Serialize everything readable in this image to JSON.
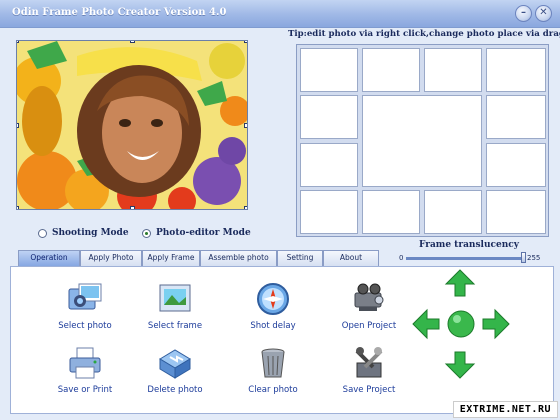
{
  "window": {
    "title": "Odin Frame Photo Creator Version 4.0",
    "minimize_icon": "minimize-icon",
    "close_icon": "close-icon"
  },
  "preview": {
    "photo_description_icon": "portrait-with-fruit-frame",
    "modes": [
      {
        "label": "Shooting Mode",
        "selected": false
      },
      {
        "label": "Photo-editor Mode",
        "selected": true
      }
    ]
  },
  "tip": "Tip:edit photo via right click,change photo place via drag it",
  "frame_translucency": {
    "label": "Frame translucency",
    "min": "0",
    "max": "255",
    "value": 255
  },
  "tabs": [
    {
      "label": "Operation",
      "active": true
    },
    {
      "label": "Apply Photo",
      "active": false
    },
    {
      "label": "Apply Frame",
      "active": false
    },
    {
      "label": "Assemble photo",
      "active": false
    },
    {
      "label": "Setting",
      "active": false
    },
    {
      "label": "About",
      "active": false
    }
  ],
  "tools": [
    {
      "label": "Select photo",
      "icon": "camera-photo-icon"
    },
    {
      "label": "Select frame",
      "icon": "frame-picture-icon"
    },
    {
      "label": "Shot delay",
      "icon": "compass-timer-icon"
    },
    {
      "label": "Open Project",
      "icon": "projector-icon"
    },
    {
      "label": "Save or Print",
      "icon": "printer-icon"
    },
    {
      "label": "Delete photo",
      "icon": "delete-folder-icon"
    },
    {
      "label": "Clear photo",
      "icon": "trash-can-icon"
    },
    {
      "label": "Save Project",
      "icon": "tools-save-icon"
    }
  ],
  "watermark": "EXTRIME.NET.RU",
  "colors": {
    "accent": "#2aa640",
    "link": "#1c3b9a",
    "tab_active": "#86a7e2"
  }
}
